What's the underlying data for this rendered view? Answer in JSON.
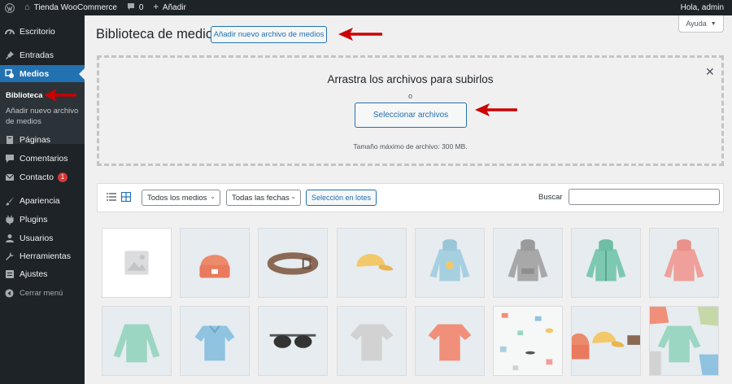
{
  "adminbar": {
    "site_name": "Tienda WooCommerce",
    "comments_count": "0",
    "new_label": "Añadir",
    "greeting": "Hola, admin"
  },
  "sidebar": {
    "items": [
      {
        "label": "Escritorio",
        "icon": "dashboard-icon"
      },
      {
        "label": "Entradas",
        "icon": "pin-icon"
      },
      {
        "label": "Medios",
        "icon": "media-icon"
      },
      {
        "label": "Páginas",
        "icon": "page-icon"
      },
      {
        "label": "Comentarios",
        "icon": "comment-icon"
      },
      {
        "label": "Contacto",
        "icon": "mail-icon",
        "badge": "1"
      },
      {
        "label": "Apariencia",
        "icon": "brush-icon"
      },
      {
        "label": "Plugins",
        "icon": "plug-icon"
      },
      {
        "label": "Usuarios",
        "icon": "user-icon"
      },
      {
        "label": "Herramientas",
        "icon": "wrench-icon"
      },
      {
        "label": "Ajustes",
        "icon": "settings-icon"
      }
    ],
    "submenu": {
      "library": "Biblioteca",
      "add_new_line1": "Añadir nuevo archivo",
      "add_new_line2": "de medios"
    },
    "collapse": "Cerrar menú"
  },
  "header": {
    "title": "Biblioteca de medios",
    "add_new_button": "Añadir nuevo archivo de medios",
    "help": "Ayuda"
  },
  "uploader": {
    "title": "Arrastra los archivos para subirlos",
    "or": "o",
    "select_button": "Seleccionar archivos",
    "max_size": "Tamaño máximo de archivo: 300 MB."
  },
  "toolbar": {
    "media_filter": "Todos los medios",
    "date_filter": "Todas las fechas",
    "bulk_select": "Selección en lotes",
    "search_label": "Buscar"
  },
  "colors": {
    "admin_dark": "#1d2327",
    "accent": "#2271b1",
    "annotation_arrow": "#cc0000",
    "badge": "#d63638"
  },
  "media": [
    "placeholder-image",
    "beanie",
    "belt",
    "cap",
    "hoodie-with-logo",
    "hoodie-grey",
    "hoodie-zip",
    "hoodie-pink",
    "long-sleeve-tee",
    "polo",
    "sunglasses",
    "tshirt-grey",
    "tshirt-coral",
    "pattern-collage",
    "cap-collage",
    "clothes-collage"
  ]
}
